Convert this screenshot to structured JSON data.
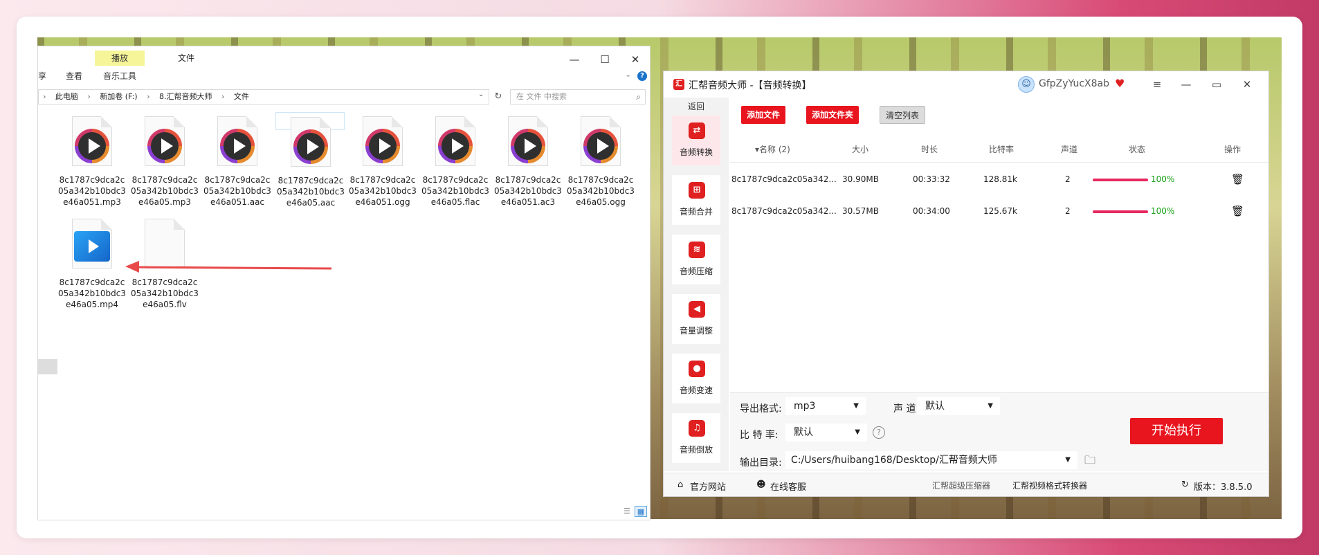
{
  "explorer": {
    "ribbon": {
      "share_partial": "享",
      "view_tab": "查看",
      "play_tab": "播放",
      "file_tab": "文件",
      "music_tools": "音乐工具"
    },
    "window_controls": {
      "minimize": "—",
      "maximize": "☐",
      "close": "✕"
    },
    "help": "?",
    "expand_chevron": "⌄",
    "address": {
      "lead": "›",
      "crumbs": [
        "此电脑",
        "新加卷 (F:)",
        "8.汇帮音频大师",
        "文件"
      ],
      "dropdown": "⌄",
      "refresh": "↻"
    },
    "search_placeholder": "在 文件 中搜索",
    "search_icon": "⌕",
    "files": [
      {
        "name": "8c1787c9dca2c05a342b10bdc3e46a051.mp3",
        "icon": "media-player-icon"
      },
      {
        "name": "8c1787c9dca2c05a342b10bdc3e46a05.mp3",
        "icon": "media-player-icon"
      },
      {
        "name": "8c1787c9dca2c05a342b10bdc3e46a051.aac",
        "icon": "media-player-icon"
      },
      {
        "name": "8c1787c9dca2c05a342b10bdc3e46a05.aac",
        "icon": "media-player-icon"
      },
      {
        "name": "8c1787c9dca2c05a342b10bdc3e46a051.ogg",
        "icon": "media-player-icon"
      },
      {
        "name": "8c1787c9dca2c05a342b10bdc3e46a05.flac",
        "icon": "media-player-icon"
      },
      {
        "name": "8c1787c9dca2c05a342b10bdc3e46a051.ac3",
        "icon": "media-player-icon"
      },
      {
        "name": "8c1787c9dca2c05a342b10bdc3e46a05.ogg",
        "icon": "media-player-icon"
      },
      {
        "name": "8c1787c9dca2c05a342b10bdc3e46a05.mp4",
        "icon": "video-file-icon"
      },
      {
        "name": "8c1787c9dca2c05a342b10bdc3e46a05.flv",
        "icon": "blank-file-icon"
      }
    ],
    "view_icons": {
      "details": "☰",
      "large": "▦"
    }
  },
  "app": {
    "logo": "汇",
    "title": "汇帮音频大师  -【音频转换】",
    "user": "GfpZyYucX8ab",
    "vip_icon": "♥",
    "window_controls": {
      "menu": "≡",
      "minimize": "—",
      "maximize": "▭",
      "close": "✕"
    },
    "back": "返回",
    "nav": [
      {
        "label": "音频转换",
        "icon": "⇄"
      },
      {
        "label": "音频合并",
        "icon": "⊞"
      },
      {
        "label": "音频压缩",
        "icon": "≋"
      },
      {
        "label": "音量调整",
        "icon": "◀"
      },
      {
        "label": "音频变速",
        "icon": "●"
      },
      {
        "label": "音频倒放",
        "icon": "♫"
      }
    ],
    "toolbar": {
      "add_file": "添加文件",
      "add_folder": "添加文件夹",
      "clear_list": "清空列表"
    },
    "table": {
      "headers": {
        "name": "▾名称 (2)",
        "size": "大小",
        "duration": "时长",
        "bitrate": "比特率",
        "channel": "声道",
        "status": "状态",
        "action": "操作"
      },
      "rows": [
        {
          "name": "8c1787c9dca2c05a342...",
          "size": "30.90MB",
          "duration": "00:33:32",
          "bitrate": "128.81k",
          "channel": "2",
          "progress": 100,
          "progress_text": "100%"
        },
        {
          "name": "8c1787c9dca2c05a342...",
          "size": "30.57MB",
          "duration": "00:34:00",
          "bitrate": "125.67k",
          "channel": "2",
          "progress": 100,
          "progress_text": "100%"
        }
      ]
    },
    "options": {
      "format_label": "导出格式:",
      "format_value": "mp3",
      "channel_label": "声 道:",
      "channel_value": "默认",
      "bitrate_label": "比 特 率:",
      "bitrate_value": "默认",
      "output_label": "输出目录:",
      "output_value": "C:/Users/huibang168/Desktop/汇帮音频大师",
      "dropdown_caret": "▼",
      "help": "?",
      "folder_icon": "🗀",
      "start": "开始执行"
    },
    "footer": {
      "home_icon": "⌂",
      "site": "官方网站",
      "service_icon": "☻",
      "service": "在线客服",
      "link1": "汇帮超级压缩器",
      "link2": "汇帮视频格式转换器",
      "refresh_icon": "↻",
      "version": "版本：3.8.5.0"
    },
    "colors": {
      "accent": "#e8141e",
      "progress": "#e8285f",
      "done_text": "#14a014"
    }
  }
}
